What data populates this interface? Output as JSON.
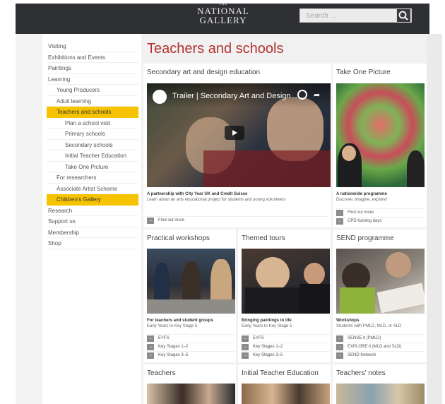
{
  "header": {
    "logo_the": "THE",
    "logo_line1": "NATIONAL",
    "logo_line2": "GALLERY",
    "search_placeholder": "Search ..."
  },
  "sidebar": {
    "items": [
      {
        "label": "Visiting",
        "level": 1,
        "active": false
      },
      {
        "label": "Exhibitions and Events",
        "level": 1,
        "active": false
      },
      {
        "label": "Paintings",
        "level": 1,
        "active": false
      },
      {
        "label": "Learning",
        "level": 1,
        "active": false
      },
      {
        "label": "Young Producers",
        "level": 2,
        "active": false
      },
      {
        "label": "Adult learning",
        "level": 2,
        "active": false
      },
      {
        "label": "Teachers and schools",
        "level": 2,
        "active": true
      },
      {
        "label": "Plan a school visit",
        "level": 3,
        "active": false
      },
      {
        "label": "Primary schools",
        "level": 3,
        "active": false
      },
      {
        "label": "Secondary schools",
        "level": 3,
        "active": false
      },
      {
        "label": "Initial Teacher Education",
        "level": 3,
        "active": false
      },
      {
        "label": "Take One Picture",
        "level": 3,
        "active": false
      },
      {
        "label": "For researchers",
        "level": 2,
        "active": false
      },
      {
        "label": "Associate Artist Scheme",
        "level": 2,
        "active": false
      },
      {
        "label": "Children's Gallery",
        "level": 2,
        "active": true
      },
      {
        "label": "Research",
        "level": 1,
        "active": false
      },
      {
        "label": "Support us",
        "level": 1,
        "active": false
      },
      {
        "label": "Membership",
        "level": 1,
        "active": false
      },
      {
        "label": "Shop",
        "level": 1,
        "active": false
      }
    ]
  },
  "page": {
    "title": "Teachers and schools"
  },
  "cards": {
    "secondary": {
      "title": "Secondary art and design education",
      "video_title": "Trailer | Secondary Art and Design...",
      "subtitle": "A partnership with City Year UK and Credit Suisse",
      "desc": "Learn about an arts educational project for students and young volunteers",
      "links": [
        "Find out more"
      ]
    },
    "take_one": {
      "title": "Take One Picture",
      "subtitle": "A nationwide programme",
      "desc": "Discover, imagine, explore!",
      "links": [
        "Find out more",
        "CPD training days"
      ]
    },
    "workshops": {
      "title": "Practical workshops",
      "subtitle": "For teachers and student groups",
      "desc": "Early Years to Key Stage 5",
      "links": [
        "EYFS",
        "Key Stages 1–2",
        "Key Stages 3–5"
      ]
    },
    "tours": {
      "title": "Themed tours",
      "subtitle": "Bringing paintings to life",
      "desc": "Early Years to Key Stage 5",
      "links": [
        "EYFS",
        "Key Stages 1–2",
        "Key Stages 3–5"
      ]
    },
    "send": {
      "title": "SEND programme",
      "subtitle": "Workshops",
      "desc": "Students with PMLD, MLD, or SLD",
      "links": [
        "SENSE it (PMLD)",
        "EXPLORE it (MLD and SLD)",
        "SEND Network"
      ]
    },
    "teachers": {
      "title": "Teachers"
    },
    "ite": {
      "title": "Initial Teacher Education"
    },
    "notes": {
      "title": "Teachers' notes"
    }
  },
  "colors": {
    "accent": "#b3322e",
    "highlight": "#f6c300",
    "header": "#2f3033"
  }
}
